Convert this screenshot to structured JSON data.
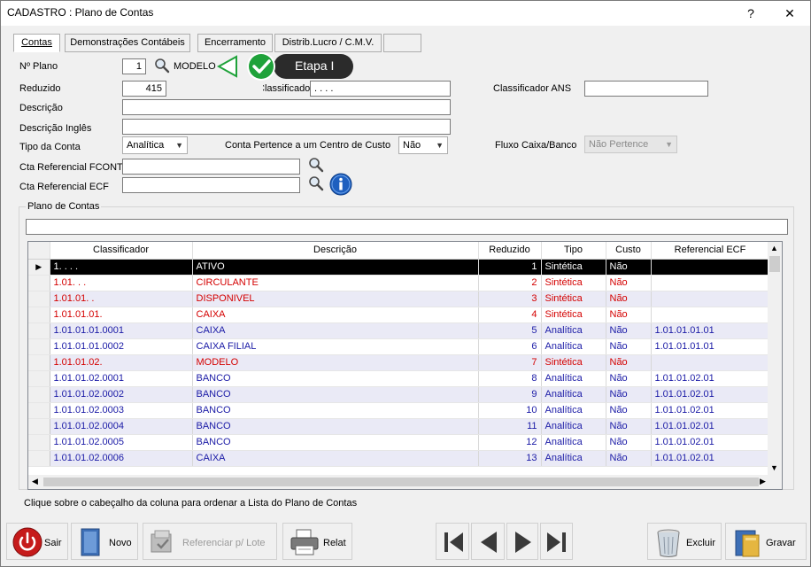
{
  "window": {
    "title": "CADASTRO : Plano de Contas",
    "help_label": "?",
    "close_label": "✕"
  },
  "tabs": [
    {
      "label": "Contas"
    },
    {
      "label": "Demonstrações Contábeis"
    },
    {
      "label": "Encerramento"
    },
    {
      "label": "Distrib.Lucro / C.M.V."
    },
    {
      "label": ""
    }
  ],
  "form": {
    "plano_label": "Nº Plano",
    "plano_value": "1",
    "plano_name": "MODELO",
    "reduzido_label": "Reduzido",
    "reduzido_value": "415",
    "classificador_label": "Classificador",
    "classificador_value": ". . . .",
    "classificador_ans_label": "Classificador ANS",
    "classificador_ans_value": "",
    "descricao_label": "Descrição",
    "descricao_value": "",
    "descricao_ingles_label": "Descrição Inglês",
    "descricao_ingles_value": "",
    "tipo_label": "Tipo da Conta",
    "tipo_value": "Analítica",
    "centro_custo_label": "Conta Pertence a um Centro de Custo",
    "centro_custo_value": "Não",
    "fluxo_label": "Fluxo Caixa/Banco",
    "fluxo_value": "Não Pertence",
    "fcont_label": "Cta Referencial FCONT",
    "fcont_value": "",
    "ecf_label": "Cta Referencial ECF",
    "ecf_value": ""
  },
  "callout": {
    "label": "Etapa I",
    "color": "#1fa23a"
  },
  "grid": {
    "group_label": "Plano de Contas",
    "filter_value": "",
    "columns": [
      "Classificador",
      "Descrição",
      "Reduzido",
      "Tipo",
      "Custo",
      "Referencial ECF"
    ],
    "rows": [
      {
        "classificador": "1. . . .",
        "descricao": "ATIVO",
        "reduzido": "1",
        "tipo": "Sintética",
        "custo": "Não",
        "ecf": "",
        "style": "selected"
      },
      {
        "classificador": "1.01. . .",
        "descricao": "CIRCULANTE",
        "reduzido": "2",
        "tipo": "Sintética",
        "custo": "Não",
        "ecf": "",
        "style": "red"
      },
      {
        "classificador": "1.01.01. .",
        "descricao": "DISPONIVEL",
        "reduzido": "3",
        "tipo": "Sintética",
        "custo": "Não",
        "ecf": "",
        "style": "red"
      },
      {
        "classificador": "1.01.01.01.",
        "descricao": "CAIXA",
        "reduzido": "4",
        "tipo": "Sintética",
        "custo": "Não",
        "ecf": "",
        "style": "red"
      },
      {
        "classificador": "1.01.01.01.0001",
        "descricao": "CAIXA",
        "reduzido": "5",
        "tipo": "Analítica",
        "custo": "Não",
        "ecf": "1.01.01.01.01",
        "style": "blue"
      },
      {
        "classificador": "1.01.01.01.0002",
        "descricao": "CAIXA FILIAL",
        "reduzido": "6",
        "tipo": "Analítica",
        "custo": "Não",
        "ecf": "1.01.01.01.01",
        "style": "blue"
      },
      {
        "classificador": "1.01.01.02.",
        "descricao": "MODELO",
        "reduzido": "7",
        "tipo": "Sintética",
        "custo": "Não",
        "ecf": "",
        "style": "red"
      },
      {
        "classificador": "1.01.01.02.0001",
        "descricao": "BANCO",
        "reduzido": "8",
        "tipo": "Analítica",
        "custo": "Não",
        "ecf": "1.01.01.02.01",
        "style": "blue"
      },
      {
        "classificador": "1.01.01.02.0002",
        "descricao": "BANCO",
        "reduzido": "9",
        "tipo": "Analítica",
        "custo": "Não",
        "ecf": "1.01.01.02.01",
        "style": "blue"
      },
      {
        "classificador": "1.01.01.02.0003",
        "descricao": "BANCO",
        "reduzido": "10",
        "tipo": "Analítica",
        "custo": "Não",
        "ecf": "1.01.01.02.01",
        "style": "blue"
      },
      {
        "classificador": "1.01.01.02.0004",
        "descricao": "BANCO",
        "reduzido": "11",
        "tipo": "Analítica",
        "custo": "Não",
        "ecf": "1.01.01.02.01",
        "style": "blue"
      },
      {
        "classificador": "1.01.01.02.0005",
        "descricao": "BANCO",
        "reduzido": "12",
        "tipo": "Analítica",
        "custo": "Não",
        "ecf": "1.01.01.02.01",
        "style": "blue"
      },
      {
        "classificador": "1.01.01.02.0006",
        "descricao": "CAIXA",
        "reduzido": "13",
        "tipo": "Analítica",
        "custo": "Não",
        "ecf": "1.01.01.02.01",
        "style": "blue"
      }
    ],
    "hint": "Clique sobre o cabeçalho da coluna para ordenar a Lista do Plano de Contas"
  },
  "buttons": {
    "sair": "Sair",
    "novo": "Novo",
    "referenciar": "Referenciar p/ Lote",
    "relat": "Relat",
    "excluir": "Excluir",
    "gravar": "Gravar"
  },
  "colors": {
    "sintetica_row": "#d40000",
    "analitica_row": "#1a1aa6",
    "selected_row": "#000000",
    "alt_row": "#eaeaf6"
  }
}
